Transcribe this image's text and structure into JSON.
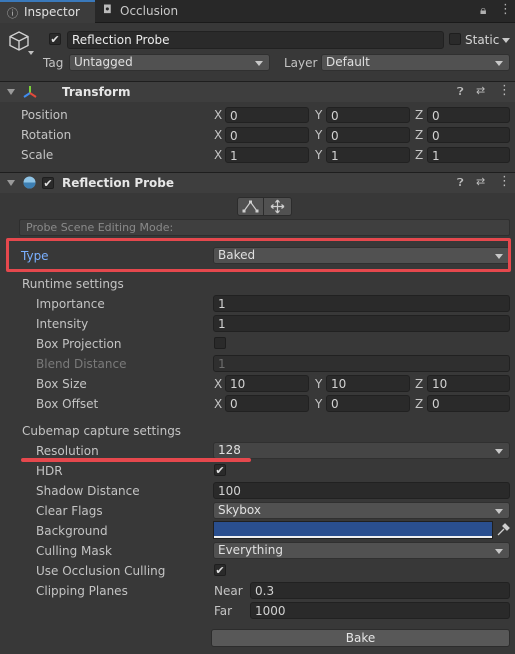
{
  "tabs": [
    {
      "label": "Inspector",
      "icon": "inspector-icon"
    },
    {
      "label": "Occlusion",
      "icon": "occlusion-icon"
    }
  ],
  "object": {
    "name": "Reflection Probe",
    "active": true,
    "static_label": "Static",
    "static_checked": false,
    "tag_label": "Tag",
    "tag_value": "Untagged",
    "layer_label": "Layer",
    "layer_value": "Default"
  },
  "transform": {
    "title": "Transform",
    "rows": [
      {
        "label": "Position",
        "x": "0",
        "y": "0",
        "z": "0"
      },
      {
        "label": "Rotation",
        "x": "0",
        "y": "0",
        "z": "0"
      },
      {
        "label": "Scale",
        "x": "1",
        "y": "1",
        "z": "1"
      }
    ]
  },
  "axes": {
    "x": "X",
    "y": "Y",
    "z": "Z"
  },
  "probe": {
    "title": "Reflection Probe",
    "enabled": true,
    "editing_mode_label": "Probe Scene Editing Mode:",
    "type_label": "Type",
    "type_value": "Baked",
    "runtime_header": "Runtime settings",
    "importance_label": "Importance",
    "importance_value": "1",
    "intensity_label": "Intensity",
    "intensity_value": "1",
    "box_projection_label": "Box Projection",
    "box_projection_checked": false,
    "blend_distance_label": "Blend Distance",
    "blend_distance_value": "1",
    "box_size_label": "Box Size",
    "box_size": {
      "x": "10",
      "y": "10",
      "z": "10"
    },
    "box_offset_label": "Box Offset",
    "box_offset": {
      "x": "0",
      "y": "0",
      "z": "0"
    },
    "cubemap_header": "Cubemap capture settings",
    "resolution_label": "Resolution",
    "resolution_value": "128",
    "hdr_label": "HDR",
    "hdr_checked": true,
    "shadow_distance_label": "Shadow Distance",
    "shadow_distance_value": "100",
    "clear_flags_label": "Clear Flags",
    "clear_flags_value": "Skybox",
    "background_label": "Background",
    "background_color": "#2a4f8f",
    "culling_mask_label": "Culling Mask",
    "culling_mask_value": "Everything",
    "occlusion_culling_label": "Use Occlusion Culling",
    "occlusion_culling_checked": true,
    "clipping_planes_label": "Clipping Planes",
    "near_label": "Near",
    "near_value": "0.3",
    "far_label": "Far",
    "far_value": "1000",
    "bake_button": "Bake"
  },
  "colors": {
    "highlight_red": "#e5484d",
    "type_label_blue": "#7ab0ff",
    "background": "#383838"
  }
}
